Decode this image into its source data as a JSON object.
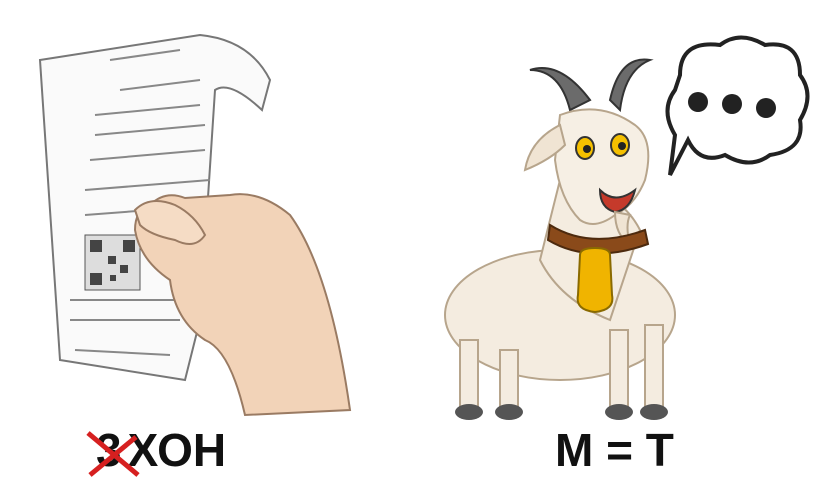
{
  "left_caption": {
    "struck_letter": "3",
    "word": "ХОН"
  },
  "right_caption": {
    "text": "М = Т"
  },
  "colors": {
    "strike": "#d62020",
    "skin": "#f2d3b8",
    "goat": "#f4ece0",
    "bell": "#f0b400",
    "collar": "#8a4a1a"
  }
}
